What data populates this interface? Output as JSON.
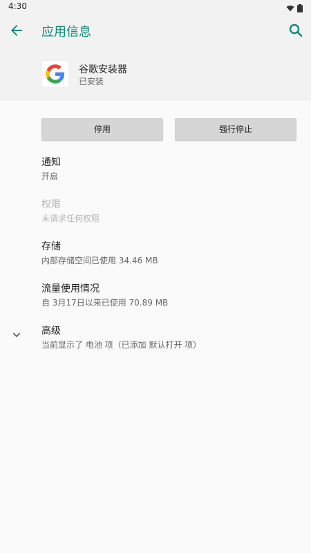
{
  "status_bar": {
    "time": "4:30",
    "icons": [
      "wifi-icon",
      "battery-icon"
    ]
  },
  "app_bar": {
    "title": "应用信息",
    "back_icon": "arrow-back-icon",
    "search_icon": "search-icon",
    "accent": "#0f8a7c"
  },
  "app": {
    "name": "谷歌安装器",
    "status": "已安装",
    "icon": "google-g-icon"
  },
  "buttons": {
    "disable": "停用",
    "force_stop": "强行停止"
  },
  "settings": [
    {
      "title": "通知",
      "subtitle": "开启",
      "enabled": true
    },
    {
      "title": "权限",
      "subtitle": "未请求任何权限",
      "enabled": false
    },
    {
      "title": "存储",
      "subtitle": "内部存储空间已使用 34.46 MB",
      "enabled": true
    },
    {
      "title": "流量使用情况",
      "subtitle": "自 3月17日以来已使用 70.89 MB",
      "enabled": true
    },
    {
      "title": "高级",
      "subtitle": "当前显示了 电池 项（已添加 默认打开 项）",
      "enabled": true,
      "icon": "chevron-down-icon"
    }
  ]
}
